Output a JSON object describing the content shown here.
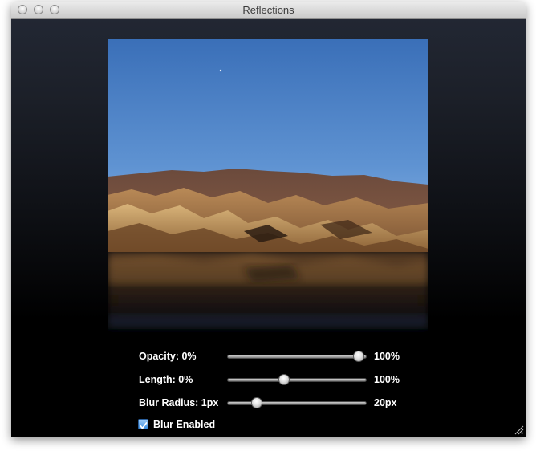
{
  "window": {
    "title": "Reflections"
  },
  "image": {
    "description_icon": "landscape-photo-icon"
  },
  "controls": {
    "opacity": {
      "label": "Opacity: 0%",
      "max_label": "100%",
      "value_fraction": 0.94
    },
    "length": {
      "label": "Length: 0%",
      "max_label": "100%",
      "value_fraction": 0.41
    },
    "blur_radius": {
      "label": "Blur Radius: 1px",
      "max_label": "20px",
      "value_fraction": 0.21
    },
    "blur_enabled": {
      "label": "Blur Enabled",
      "checked": true
    }
  },
  "colors": {
    "accent": "#3b8de0",
    "background_top": "#222733",
    "background_bottom": "#000000"
  }
}
